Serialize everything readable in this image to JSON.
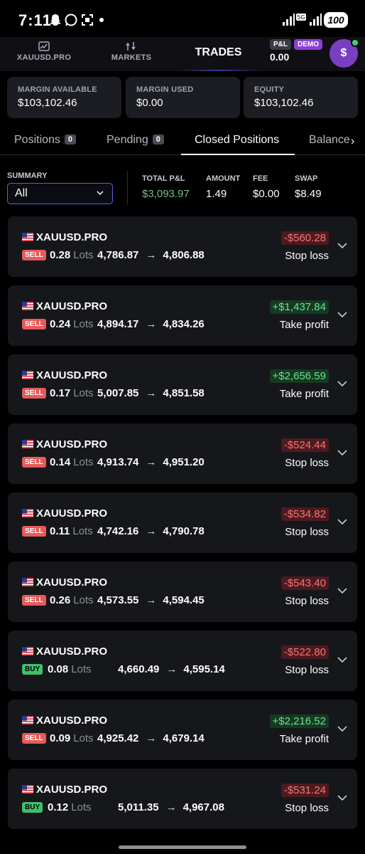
{
  "status_bar": {
    "time": "7:11",
    "battery": "100"
  },
  "nav": {
    "symbol_tab": "XAUUSD.PRO",
    "markets_tab": "MARKETS",
    "trades_tab": "TRADES",
    "pl_badge": "P&L",
    "demo_badge": "DEMO",
    "pl_value": "0.00",
    "avatar": "$"
  },
  "account": {
    "margin_available_label": "MARGIN AVAILABLE",
    "margin_available": "$103,102.46",
    "margin_used_label": "MARGIN USED",
    "margin_used": "$0.00",
    "equity_label": "EQUITY",
    "equity": "$103,102.46"
  },
  "tabs": {
    "positions": "Positions",
    "positions_count": "0",
    "pending": "Pending",
    "pending_count": "0",
    "closed": "Closed Positions",
    "balance": "Balance"
  },
  "summary": {
    "label": "SUMMARY",
    "selected": "All",
    "total_pl_label": "TOTAL P&L",
    "total_pl": "$3,093.97",
    "amount_label": "AMOUNT",
    "amount": "1.49",
    "fee_label": "FEE",
    "fee": "$0.00",
    "swap_label": "SWAP",
    "swap": "$8.49"
  },
  "colors": {
    "positive": "#6fe08e",
    "negative": "#f07777",
    "accent": "#8a3fd6",
    "select_border": "#5a64d8"
  },
  "lots_label": "Lots",
  "trades": [
    {
      "symbol": "XAUUSD.PRO",
      "side": "SELL",
      "qty": "0.28",
      "open": "4,786.87",
      "close": "4,806.88",
      "pnl": "-$560.28",
      "reason": "Stop loss"
    },
    {
      "symbol": "XAUUSD.PRO",
      "side": "SELL",
      "qty": "0.24",
      "open": "4,894.17",
      "close": "4,834.26",
      "pnl": "+$1,437.84",
      "reason": "Take profit"
    },
    {
      "symbol": "XAUUSD.PRO",
      "side": "SELL",
      "qty": "0.17",
      "open": "5,007.85",
      "close": "4,851.58",
      "pnl": "+$2,656.59",
      "reason": "Take profit"
    },
    {
      "symbol": "XAUUSD.PRO",
      "side": "SELL",
      "qty": "0.14",
      "open": "4,913.74",
      "close": "4,951.20",
      "pnl": "-$524.44",
      "reason": "Stop loss"
    },
    {
      "symbol": "XAUUSD.PRO",
      "side": "SELL",
      "qty": "0.11",
      "open": "4,742.16",
      "close": "4,790.78",
      "pnl": "-$534.82",
      "reason": "Stop loss"
    },
    {
      "symbol": "XAUUSD.PRO",
      "side": "SELL",
      "qty": "0.26",
      "open": "4,573.55",
      "close": "4,594.45",
      "pnl": "-$543.40",
      "reason": "Stop loss"
    },
    {
      "symbol": "XAUUSD.PRO",
      "side": "BUY",
      "qty": "0.08",
      "open": "4,660.49",
      "close": "4,595.14",
      "pnl": "-$522.80",
      "reason": "Stop loss"
    },
    {
      "symbol": "XAUUSD.PRO",
      "side": "SELL",
      "qty": "0.09",
      "open": "4,925.42",
      "close": "4,679.14",
      "pnl": "+$2,216.52",
      "reason": "Take profit"
    },
    {
      "symbol": "XAUUSD.PRO",
      "side": "BUY",
      "qty": "0.12",
      "open": "5,011.35",
      "close": "4,967.08",
      "pnl": "-$531.24",
      "reason": "Stop loss"
    }
  ]
}
